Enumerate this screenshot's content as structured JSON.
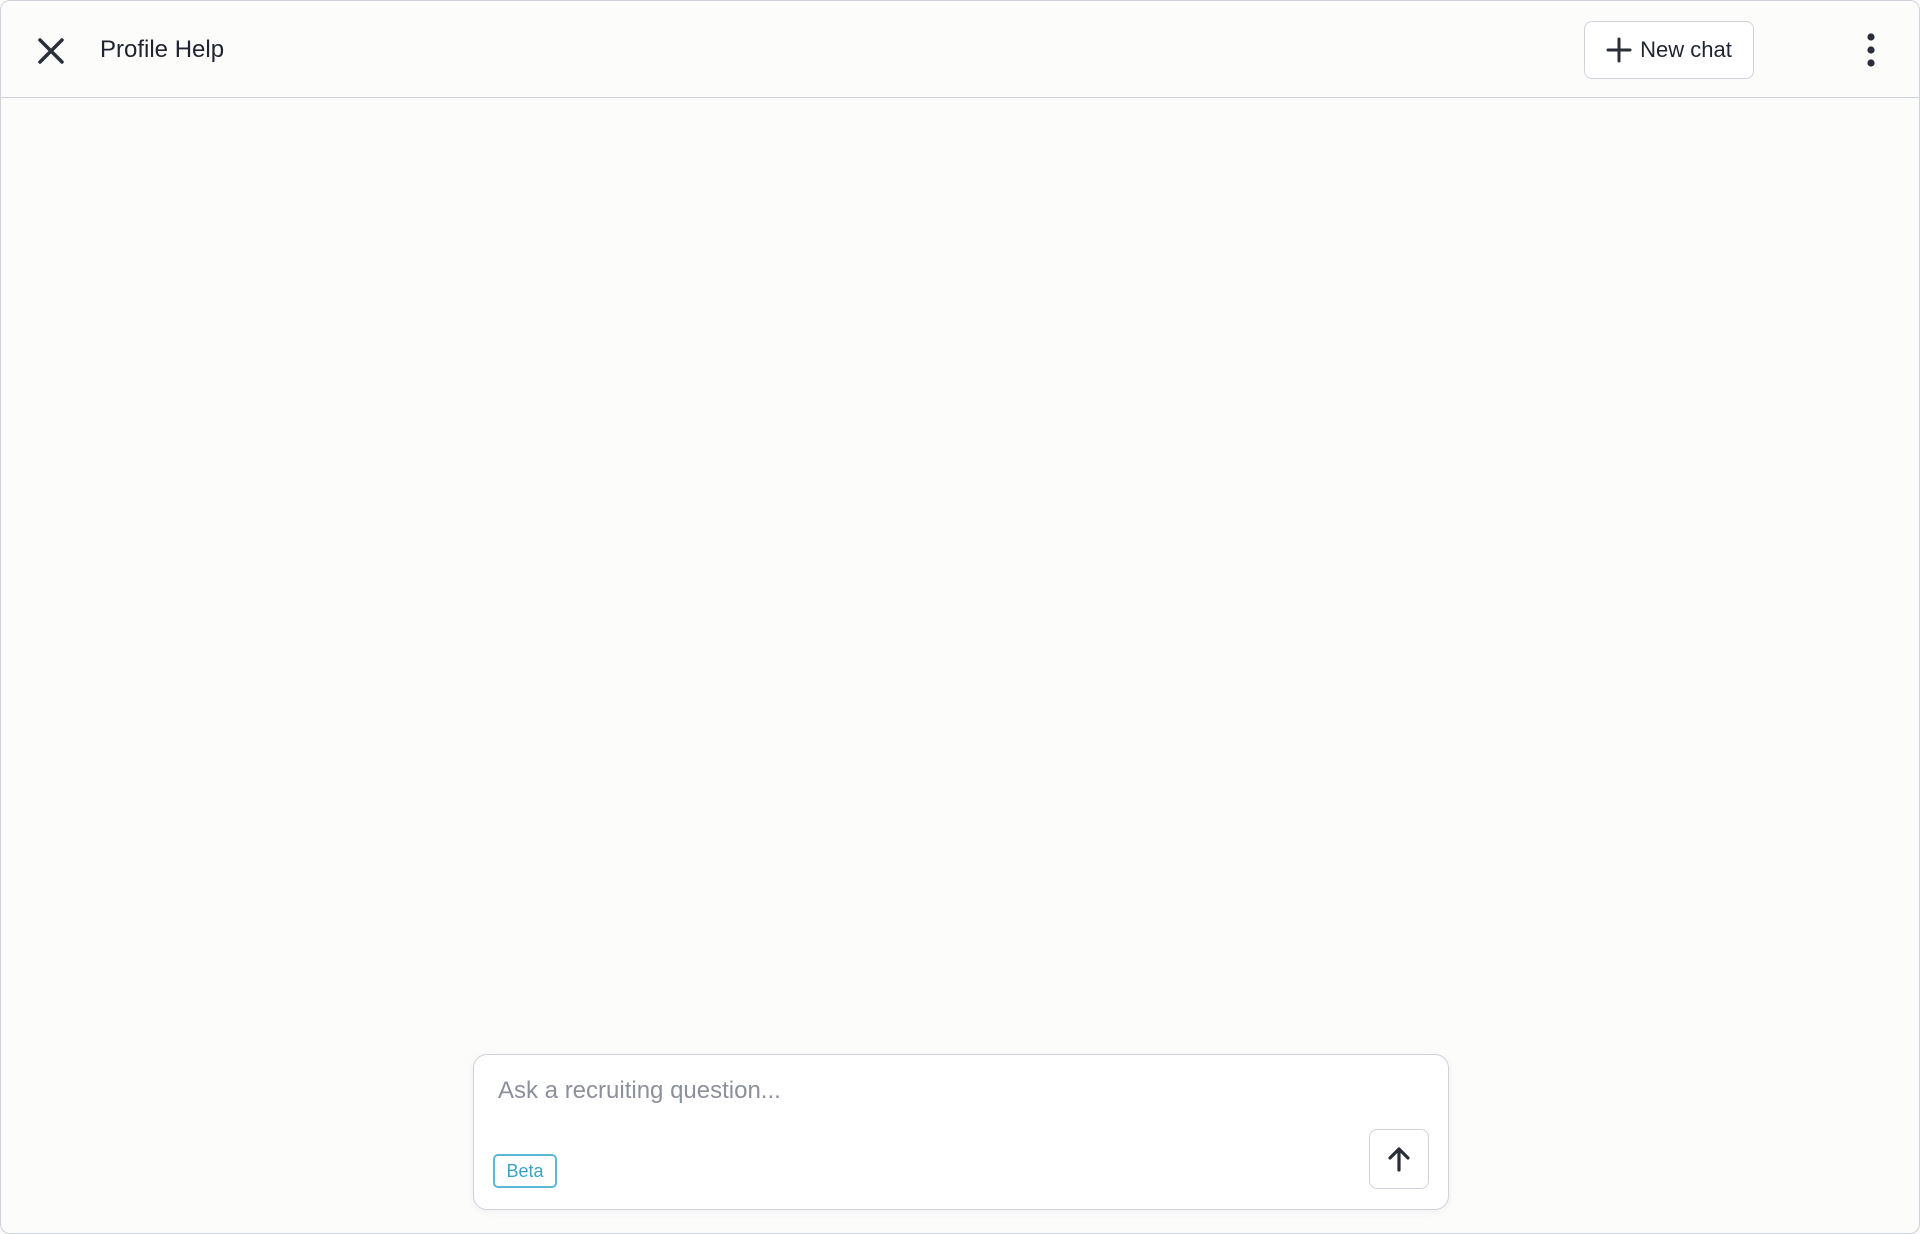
{
  "header": {
    "title": "Profile Help",
    "close_icon": "close-icon",
    "new_chat_label": "New chat",
    "new_chat_icon": "plus-icon",
    "more_icon": "more-vertical-icon"
  },
  "composer": {
    "placeholder": "Ask a recruiting question...",
    "value": "",
    "badge": "Beta",
    "send_icon": "arrow-up-icon"
  },
  "colors": {
    "background": "#fcfcfb",
    "border": "#cfd2db",
    "text": "#1f2430",
    "placeholder": "#8c909b",
    "beta_accent": "#5ab8d6"
  }
}
